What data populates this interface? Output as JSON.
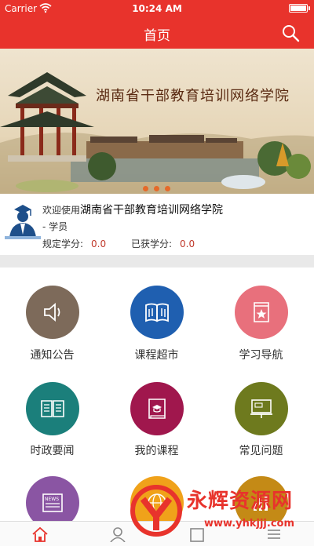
{
  "status_bar": {
    "carrier": "Carrier",
    "time": "10:24 AM"
  },
  "nav": {
    "title": "首页"
  },
  "banner": {
    "title": "湖南省干部教育培训网络学院"
  },
  "profile": {
    "welcome_prefix": "欢迎使用",
    "school_name": "湖南省干部教育培训网络学院",
    "role": "- 学员",
    "required_label": "规定学分:",
    "required_value": "0.0",
    "earned_label": "已获学分:",
    "earned_value": "0.0"
  },
  "menu": [
    {
      "label": "通知公告",
      "color": "#7d6a5a",
      "icon": "speaker-icon"
    },
    {
      "label": "课程超市",
      "color": "#1f5fb0",
      "icon": "book-open-icon"
    },
    {
      "label": "学习导航",
      "color": "#e8707c",
      "icon": "bookmark-star-icon"
    },
    {
      "label": "时政要闻",
      "color": "#1b7f7b",
      "icon": "newspaper-book-icon"
    },
    {
      "label": "我的课程",
      "color": "#a0174d",
      "icon": "graduation-book-icon"
    },
    {
      "label": "常见问题",
      "color": "#6e7a1e",
      "icon": "blackboard-icon"
    },
    {
      "label": "",
      "color": "#8a55a3",
      "icon": "news-icon"
    },
    {
      "label": "",
      "color": "#f0a21a",
      "icon": "globe-icon"
    },
    {
      "label": "",
      "color": "#c48a16",
      "icon": "chart-icon"
    }
  ],
  "news_icon_text": "NEWS",
  "watermark": {
    "text": "永辉资源网",
    "url": "www.yhkjjj.com"
  },
  "colors": {
    "primary": "#e8332c",
    "accent": "#c0392b"
  }
}
